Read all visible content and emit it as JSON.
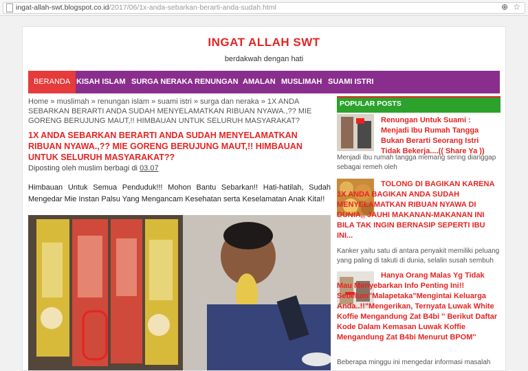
{
  "browser": {
    "url_host": "ingat-allah-swt.blogspot.co.id",
    "url_path": "/2017/06/1x-anda-sebarkan-berarti-anda-sudah.html"
  },
  "site": {
    "title": "INGAT ALLAH SWT",
    "description": "berdakwah dengan hati"
  },
  "nav": {
    "items": [
      "BERANDA",
      "KISAH ISLAM",
      "SURGA NERAKA",
      "RENUNGAN",
      "AMALAN",
      "MUSLIMAH",
      "SUAMI ISTRI"
    ],
    "active": "BERANDA"
  },
  "post": {
    "breadcrumb": "Home » muslimah » renungan islam » suami istri » surga dan neraka » 1X ANDA SEBARKAN BERARTI ANDA SUDAH MENYELAMATKAN RIBUAN NYAWA.,?? MIE GORENG BERUJUNG MAUT,!! HIMBAUAN UNTUK SELURUH MASYARAKAT?",
    "title": "1X ANDA SEBARKAN BERARTI ANDA SUDAH MENYELAMATKAN RIBUAN NYAWA.,?? MIE GORENG BERUJUNG MAUT,!! HIMBAUAN UNTUK SELURUH MASYARAKAT??",
    "meta_prefix": "Diposting oleh",
    "author": "muslim berbagi",
    "meta_di": "di",
    "date": "03.07",
    "body": "Himbauan Untuk Semua Penduduk!!! Mohon Bantu Sebarkan!! Hati-hatilah, Sudah Mengedar Mie Instan Palsu Yang Mengancam Kesehatan serta Keselamatan Anak Kita!!"
  },
  "sidebar": {
    "heading": "POPULAR POSTS",
    "posts": [
      {
        "title": "Renungan Untuk Suami : Menjadi Ibu Rumah Tangga Bukan Berarti Seorang Istri Tidak Bekerja....(( Share Ya ))",
        "snippet": "Menjadi ibu rumah tangga memang sering dianggap sebagai remeh oleh"
      },
      {
        "title": "TOLONG DI BAGIKAN KARENA 1X ANDA BAGIKAN ANDA SUDAH MENYELAMATKAN RIBUAN NYAWA DI DUNIA,, JAUHI MAKANAN-MAKANAN INI BILA TAK INGIN BERNASIP SEPERTI IBU INI...",
        "snippet": "Kanker yaitu satu di antara penyakit memiliki peluang yang paling di takuti di dunia, selalin susah sembuh"
      },
      {
        "title": "Hanya Orang Malas Yg Tidak Mau Menyebarkan Info Penting Ini!! Sebelum\"Malapetaka\"Mengintai Keluarga Anda..!!\"Mengerikan, Ternyata Luwak White Koffie Mengandung Zat B4bi '' Berikut Daftar Kode Dalam Kemasan Luwak Koffie Mengandung Zat B4bi Menurut BPOM''",
        "snippet": "Beberapa minggu ini mengedar informasi masalah"
      }
    ]
  },
  "colors": {
    "accent_red": "#e62323",
    "nav_purple": "#8a2e8e",
    "sidebar_green": "#2ca22c"
  }
}
